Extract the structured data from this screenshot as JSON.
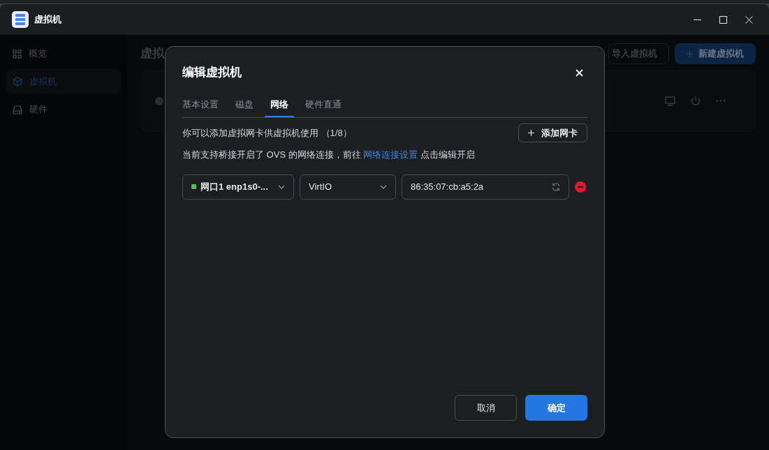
{
  "window": {
    "title": "虚拟机"
  },
  "sidebar": {
    "items": [
      {
        "label": "概览",
        "kind": "grid",
        "selected": false
      },
      {
        "label": "虚拟机",
        "kind": "cube",
        "selected": true
      },
      {
        "label": "硬件",
        "kind": "drive",
        "selected": false
      }
    ]
  },
  "page": {
    "title": "虚拟",
    "buttons": [
      {
        "label": "导入虚拟机",
        "kind": "outline"
      },
      {
        "label": "新建虚拟机",
        "kind": "primary"
      }
    ]
  },
  "dialog": {
    "title": "编辑虚拟机",
    "tabs": [
      {
        "label": "基本设置",
        "selected": false
      },
      {
        "label": "磁盘",
        "selected": false
      },
      {
        "label": "网络",
        "selected": true
      },
      {
        "label": "硬件直通",
        "selected": false
      }
    ],
    "info": "你可以添加虚拟网卡供虚拟机使用 （1/8）",
    "add_button": "添加网卡",
    "note": {
      "before": "当前支持桥接开启了 OVS 的网络连接，前往",
      "link": "网络连接设置",
      "after": "点击编辑开启"
    },
    "nics": [
      {
        "port": "网口1 enp1s0-...",
        "color": "#5cb85c",
        "model": "VirtIO",
        "mac": "86:35:07:cb:a5:2a"
      }
    ],
    "footer": [
      {
        "label": "取消",
        "kind": "secondary"
      },
      {
        "label": "确定",
        "kind": "primary"
      }
    ]
  }
}
